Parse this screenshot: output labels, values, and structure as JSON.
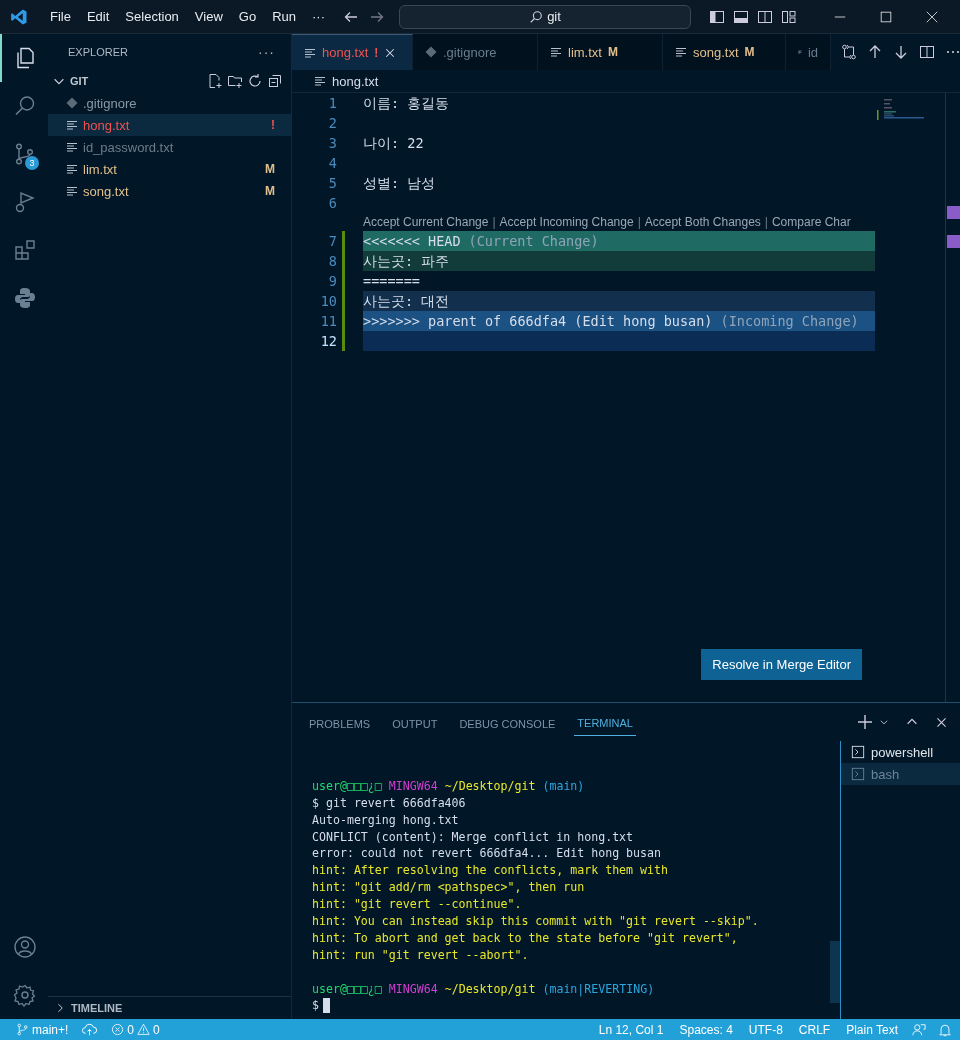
{
  "menu": [
    "File",
    "Edit",
    "Selection",
    "View",
    "Go",
    "Run",
    "···"
  ],
  "search": {
    "value": "git"
  },
  "activity_bar": {
    "items": [
      {
        "kind": "explorer",
        "selected": true
      },
      {
        "kind": "search",
        "selected": false
      },
      {
        "kind": "source_control",
        "selected": false,
        "badge": "3"
      },
      {
        "kind": "run",
        "selected": false
      },
      {
        "kind": "extensions",
        "selected": false
      },
      {
        "kind": "python",
        "selected": false
      }
    ],
    "bottom": [
      {
        "kind": "account"
      },
      {
        "kind": "settings"
      }
    ]
  },
  "sidebar": {
    "title": "EXPLORER",
    "more": "···",
    "folder": {
      "name": "GIT",
      "expanded": true,
      "files": [
        {
          "name": ".gitignore",
          "kind": "git",
          "color": "#8a99a6",
          "selected": false
        },
        {
          "name": "hong.txt",
          "kind": "text",
          "color": "#ef5350",
          "status": "!",
          "selected": true
        },
        {
          "name": "id_password.txt",
          "kind": "text",
          "color": "#6b7c8c",
          "selected": false
        },
        {
          "name": "lim.txt",
          "kind": "text",
          "color": "#e2c08d",
          "status": "M",
          "selected": false
        },
        {
          "name": "song.txt",
          "kind": "text",
          "color": "#e2c08d",
          "status": "M",
          "selected": false
        }
      ]
    },
    "timeline": {
      "title": "TIMELINE",
      "expanded": false
    }
  },
  "tabs": [
    {
      "label": "hong.txt",
      "kind": "text",
      "status": "!",
      "color": "#ef5350",
      "selected": true
    },
    {
      "label": ".gitignore",
      "kind": "git",
      "color": "#6b7c8c",
      "selected": false
    },
    {
      "label": "lim.txt",
      "kind": "text",
      "status": "M",
      "color": "#e2c08d",
      "selected": false
    },
    {
      "label": "song.txt",
      "kind": "text",
      "status": "M",
      "color": "#e2c08d",
      "selected": false
    },
    {
      "label": "id",
      "kind": "text",
      "color": "#6b7c8c",
      "selected": false
    }
  ],
  "breadcrumb": "hong.txt",
  "code_lines": [
    {
      "number": "1",
      "text": "이름: 홍길동",
      "kind": "plain",
      "current": false,
      "modified": false
    },
    {
      "number": "2",
      "kind": "plain",
      "current": false,
      "modified": false
    },
    {
      "number": "3",
      "text": "나이: 22",
      "kind": "plain",
      "current": false,
      "modified": false
    },
    {
      "number": "4",
      "kind": "plain",
      "current": false,
      "modified": false
    },
    {
      "number": "5",
      "text": "성별: 남성",
      "kind": "plain",
      "current": false,
      "modified": false
    },
    {
      "number": "6",
      "kind": "plain",
      "current": false,
      "modified": false
    },
    {
      "kind": "codelens",
      "items": [
        {
          "kind": "link",
          "text": "Accept Current Change"
        },
        {
          "kind": "separator",
          "text": "|"
        },
        {
          "kind": "link",
          "text": "Accept Incoming Change"
        },
        {
          "kind": "separator",
          "text": "|"
        },
        {
          "kind": "link",
          "text": "Accept Both Changes"
        },
        {
          "kind": "separator",
          "text": "|"
        },
        {
          "kind": "link",
          "text": "Compare Char"
        }
      ]
    },
    {
      "number": "7",
      "text": "<<<<<<< HEAD",
      "note": "(Current Change)",
      "kind": "current_marker",
      "current": false,
      "modified": true
    },
    {
      "number": "8",
      "text": "사는곳: 파주",
      "kind": "current",
      "current": false,
      "modified": true
    },
    {
      "number": "9",
      "text": "=======",
      "kind": "divider",
      "current": false,
      "modified": true
    },
    {
      "number": "10",
      "text": "사는곳: 대전",
      "kind": "incoming",
      "current": false,
      "modified": true
    },
    {
      "number": "11",
      "text": ">>>>>>> parent of 666dfa4 (Edit hong busan)",
      "note": "(Incoming Change)",
      "kind": "incoming_marker",
      "current": false,
      "modified": true
    },
    {
      "number": "12",
      "kind": "incoming_end",
      "current": true,
      "modified": true
    }
  ],
  "merge_button": "Resolve in Merge Editor",
  "panel": {
    "tabs": [
      {
        "label": "PROBLEMS",
        "selected": false
      },
      {
        "label": "OUTPUT",
        "selected": false
      },
      {
        "label": "DEBUG CONSOLE",
        "selected": false
      },
      {
        "label": "TERMINAL",
        "selected": true
      }
    ],
    "terminal": [
      {
        "kind": "blank"
      },
      {
        "kind": "prompt",
        "user": "user@□□□¿□",
        "host": "MINGW64",
        "path": "~/Desktop/git",
        "branch": "(main)"
      },
      {
        "kind": "output",
        "text": "$ git revert 666dfa406"
      },
      {
        "kind": "output",
        "text": "Auto-merging hong.txt"
      },
      {
        "kind": "output",
        "text": "CONFLICT (content): Merge conflict in hong.txt"
      },
      {
        "kind": "output",
        "text": "error: could not revert 666dfa4... Edit hong busan"
      },
      {
        "kind": "hint",
        "text": "hint: After resolving the conflicts, mark them with"
      },
      {
        "kind": "hint",
        "text": "hint: \"git add/rm <pathspec>\", then run"
      },
      {
        "kind": "hint",
        "text": "hint: \"git revert --continue\"."
      },
      {
        "kind": "hint",
        "text": "hint: You can instead skip this commit with \"git revert --skip\"."
      },
      {
        "kind": "hint",
        "text": "hint: To abort and get back to the state before \"git revert\","
      },
      {
        "kind": "hint",
        "text": "hint: run \"git revert --abort\"."
      },
      {
        "kind": "blank"
      },
      {
        "kind": "prompt",
        "user": "user@□□□¿□",
        "host": "MINGW64",
        "path": "~/Desktop/git",
        "branch": "(main|REVERTING)"
      },
      {
        "kind": "input",
        "text": "$"
      }
    ],
    "terminals": [
      {
        "name": "powershell",
        "selected": false
      },
      {
        "name": "bash",
        "selected": true
      }
    ]
  },
  "status_bar": {
    "branch": "main+!",
    "errors": "0",
    "warnings": "0",
    "items": [
      "Ln 12, Col 1",
      "Spaces: 4",
      "UTF-8",
      "CRLF",
      "Plain Text"
    ]
  }
}
